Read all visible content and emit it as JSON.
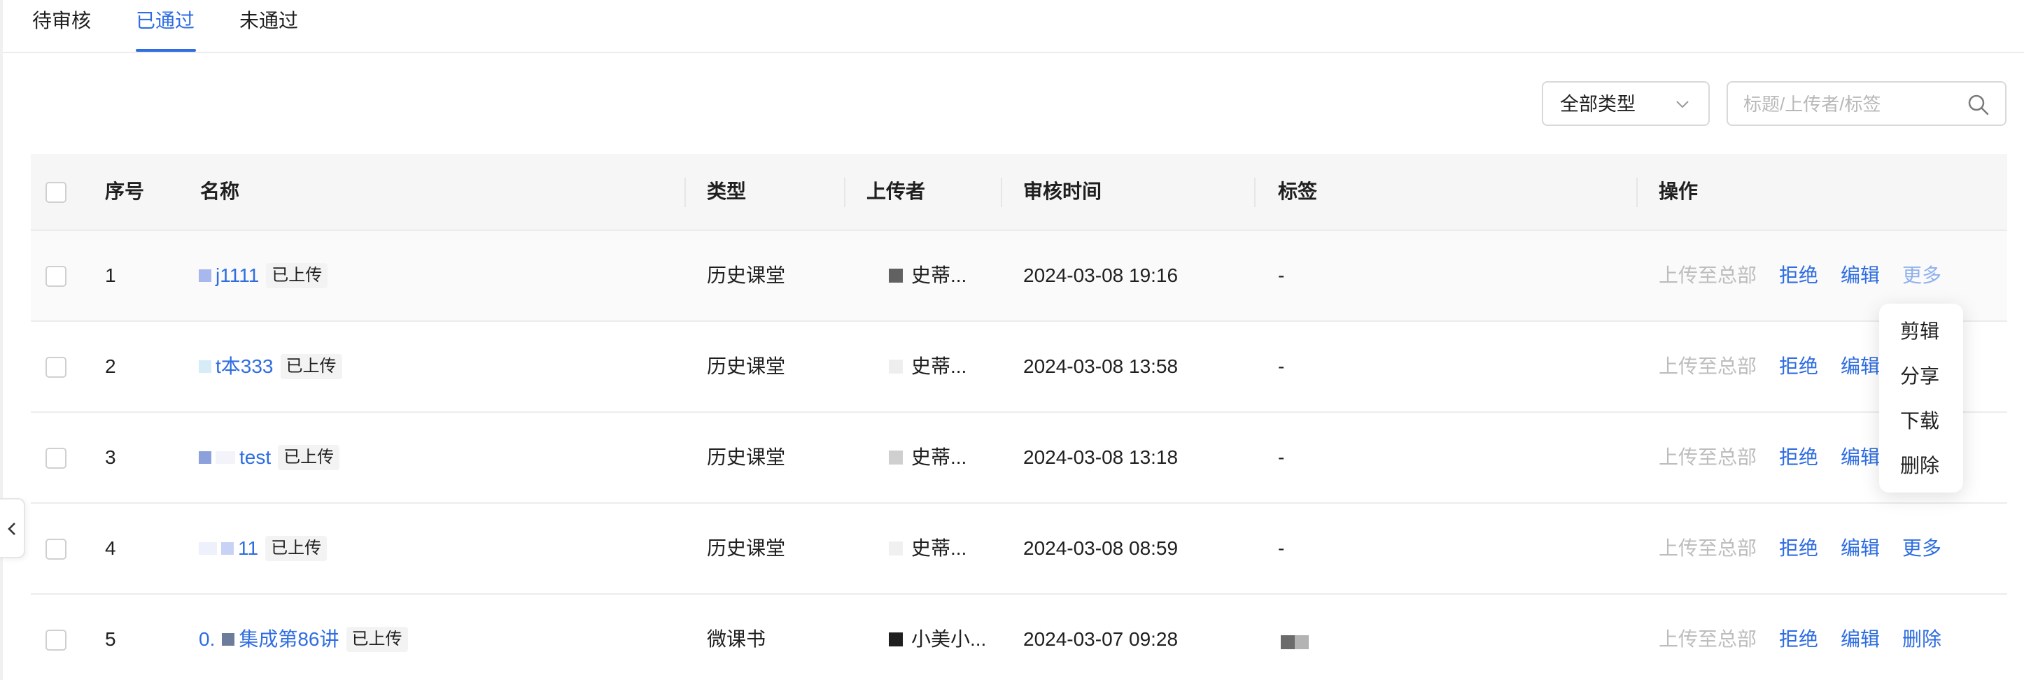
{
  "tabs": [
    {
      "label": "待审核",
      "active": false
    },
    {
      "label": "已通过",
      "active": true
    },
    {
      "label": "未通过",
      "active": false
    }
  ],
  "filters": {
    "type_select_value": "全部类型",
    "search_placeholder": "标题/上传者/标签"
  },
  "table": {
    "headers": {
      "index": "序号",
      "name": "名称",
      "type": "类型",
      "uploader": "上传者",
      "review_time": "审核时间",
      "tags": "标签",
      "actions": "操作"
    },
    "rows": [
      {
        "index": "1",
        "name": "j1111",
        "upload_tag": "已上传",
        "type": "历史课堂",
        "uploader": "史蒂...",
        "review_time": "2024-03-08 19:16",
        "tags": "-",
        "actions": {
          "upload_hq": "上传至总部",
          "reject": "拒绝",
          "edit": "编辑",
          "more": "更多"
        }
      },
      {
        "index": "2",
        "name": "t本333",
        "upload_tag": "已上传",
        "type": "历史课堂",
        "uploader": "史蒂...",
        "review_time": "2024-03-08 13:58",
        "tags": "-",
        "actions": {
          "upload_hq": "上传至总部",
          "reject": "拒绝",
          "edit": "编辑"
        }
      },
      {
        "index": "3",
        "name": "test",
        "upload_tag": "已上传",
        "type": "历史课堂",
        "uploader": "史蒂...",
        "review_time": "2024-03-08 13:18",
        "tags": "-",
        "actions": {
          "upload_hq": "上传至总部",
          "reject": "拒绝",
          "edit": "编辑"
        }
      },
      {
        "index": "4",
        "name": "11",
        "upload_tag": "已上传",
        "type": "历史课堂",
        "uploader": "史蒂...",
        "review_time": "2024-03-08 08:59",
        "tags": "-",
        "actions": {
          "upload_hq": "上传至总部",
          "reject": "拒绝",
          "edit": "编辑",
          "more": "更多"
        }
      },
      {
        "index": "5",
        "name": "集成第86讲",
        "name_prefix": "0.",
        "upload_tag": "已上传",
        "type": "微课书",
        "uploader": "小美小...",
        "review_time": "2024-03-07 09:28",
        "tags": "",
        "actions": {
          "upload_hq": "上传至总部",
          "reject": "拒绝",
          "edit": "编辑",
          "delete": "删除"
        }
      }
    ]
  },
  "more_menu": {
    "items": [
      "剪辑",
      "分享",
      "下载",
      "删除"
    ]
  },
  "colors": {
    "primary": "#2f6de1",
    "disabled": "#bdbdbd",
    "header_bg": "#f6f6f6"
  },
  "icons": [
    "chevron-down-icon",
    "search-icon",
    "chevron-left-icon"
  ]
}
